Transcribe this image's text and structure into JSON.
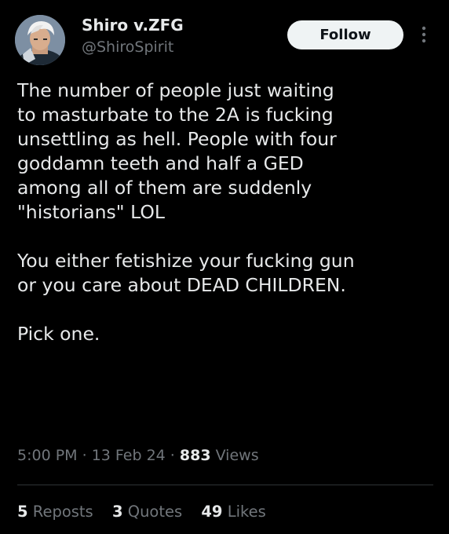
{
  "author": {
    "display_name": "Shiro v.ZFG",
    "handle": "@ShiroSpirit"
  },
  "follow_button": {
    "label": "Follow"
  },
  "more_icon": "more-vertical-icon",
  "tweet": {
    "paragraphs": [
      "The number of people just waiting\nto masturbate to the 2A is fucking\nunsettling as hell. People with four\ngoddamn teeth and half a GED\namong all of them are suddenly\n\"historians\" LOL",
      "You either fetishize your fucking gun\nor you care about DEAD CHILDREN.",
      "Pick one."
    ]
  },
  "meta": {
    "time": "5:00 PM",
    "sep1": " · ",
    "date": "13 Feb 24",
    "sep2": " · ",
    "views_count": "883",
    "views_label": " Views"
  },
  "stats": {
    "reposts_count": "5",
    "reposts_label": " Reposts",
    "quotes_count": "3",
    "quotes_label": " Quotes",
    "likes_count": "49",
    "likes_label": " Likes"
  },
  "colors": {
    "background": "#000000",
    "primary_text": "#e7e9ea",
    "secondary_text": "#71767b",
    "follow_button_bg": "#eff3f4",
    "divider": "#2f3336"
  }
}
